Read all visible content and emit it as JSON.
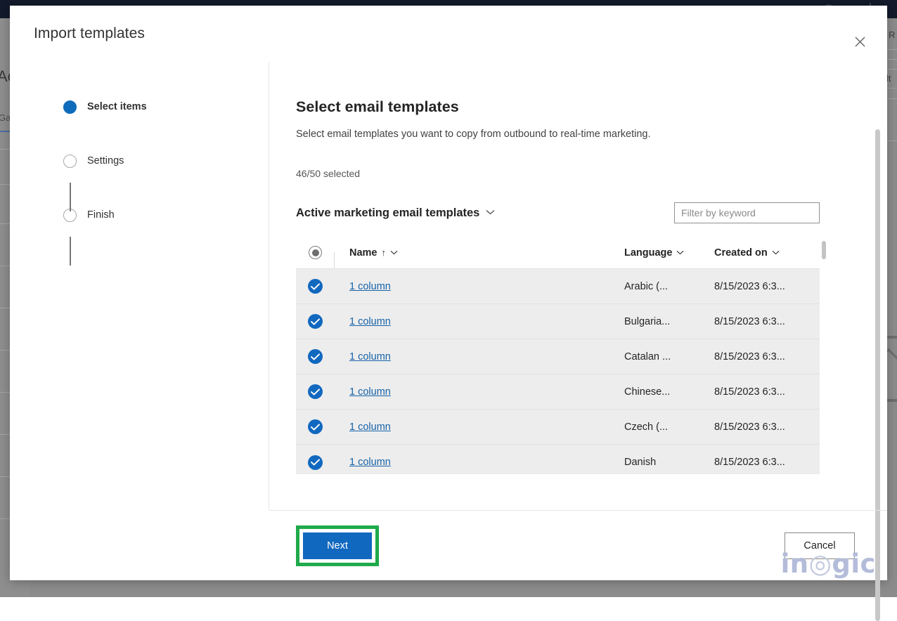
{
  "background": {
    "topbar_icons": [
      "↗",
      "⛃",
      "│"
    ],
    "left_label_1": "Ac",
    "left_label_2": "Gal",
    "right_label_1": "un R",
    "right_label_2": "Filt"
  },
  "dialog": {
    "title": "Import templates",
    "close_label": "✕"
  },
  "steps": [
    {
      "label": "Select items",
      "state": "done"
    },
    {
      "label": "Settings",
      "state": "todo"
    },
    {
      "label": "Finish",
      "state": "todo"
    }
  ],
  "main": {
    "title": "Select email templates",
    "subtitle": "Select email templates you want to copy from outbound to real-time marketing.",
    "selection_count": "46/50 selected",
    "view_name": "Active marketing email templates",
    "view_chevron": "⌄",
    "filter_placeholder": "Filter by keyword",
    "filter_value": ""
  },
  "table": {
    "columns": [
      {
        "key": "name",
        "label": "Name",
        "sort": "↑",
        "chevron": "⌄"
      },
      {
        "key": "language",
        "label": "Language",
        "chevron": "⌄"
      },
      {
        "key": "created",
        "label": "Created on",
        "chevron": "⌄"
      }
    ],
    "rows": [
      {
        "name": "1 column",
        "language": "Arabic (...",
        "created": "8/15/2023 6:3...",
        "selected": true
      },
      {
        "name": "1 column",
        "language": "Bulgaria...",
        "created": "8/15/2023 6:3...",
        "selected": true
      },
      {
        "name": "1 column",
        "language": "Catalan ...",
        "created": "8/15/2023 6:3...",
        "selected": true
      },
      {
        "name": "1 column",
        "language": "Chinese...",
        "created": "8/15/2023 6:3...",
        "selected": true
      },
      {
        "name": "1 column",
        "language": "Czech (...",
        "created": "8/15/2023 6:3...",
        "selected": true
      },
      {
        "name": "1 column",
        "language": "Danish",
        "created": "8/15/2023 6:3...",
        "selected": true
      }
    ]
  },
  "footer": {
    "next_label": "Next",
    "cancel_label": "Cancel"
  },
  "watermark": {
    "part1": "in",
    "part2": "◎",
    "part3": "gic"
  },
  "colors": {
    "accent_blue": "#1168bf",
    "link_blue": "#1763a8",
    "highlight_green": "#1faa4b",
    "row_bg": "#ededed",
    "topbar_dark": "#121a2b"
  }
}
